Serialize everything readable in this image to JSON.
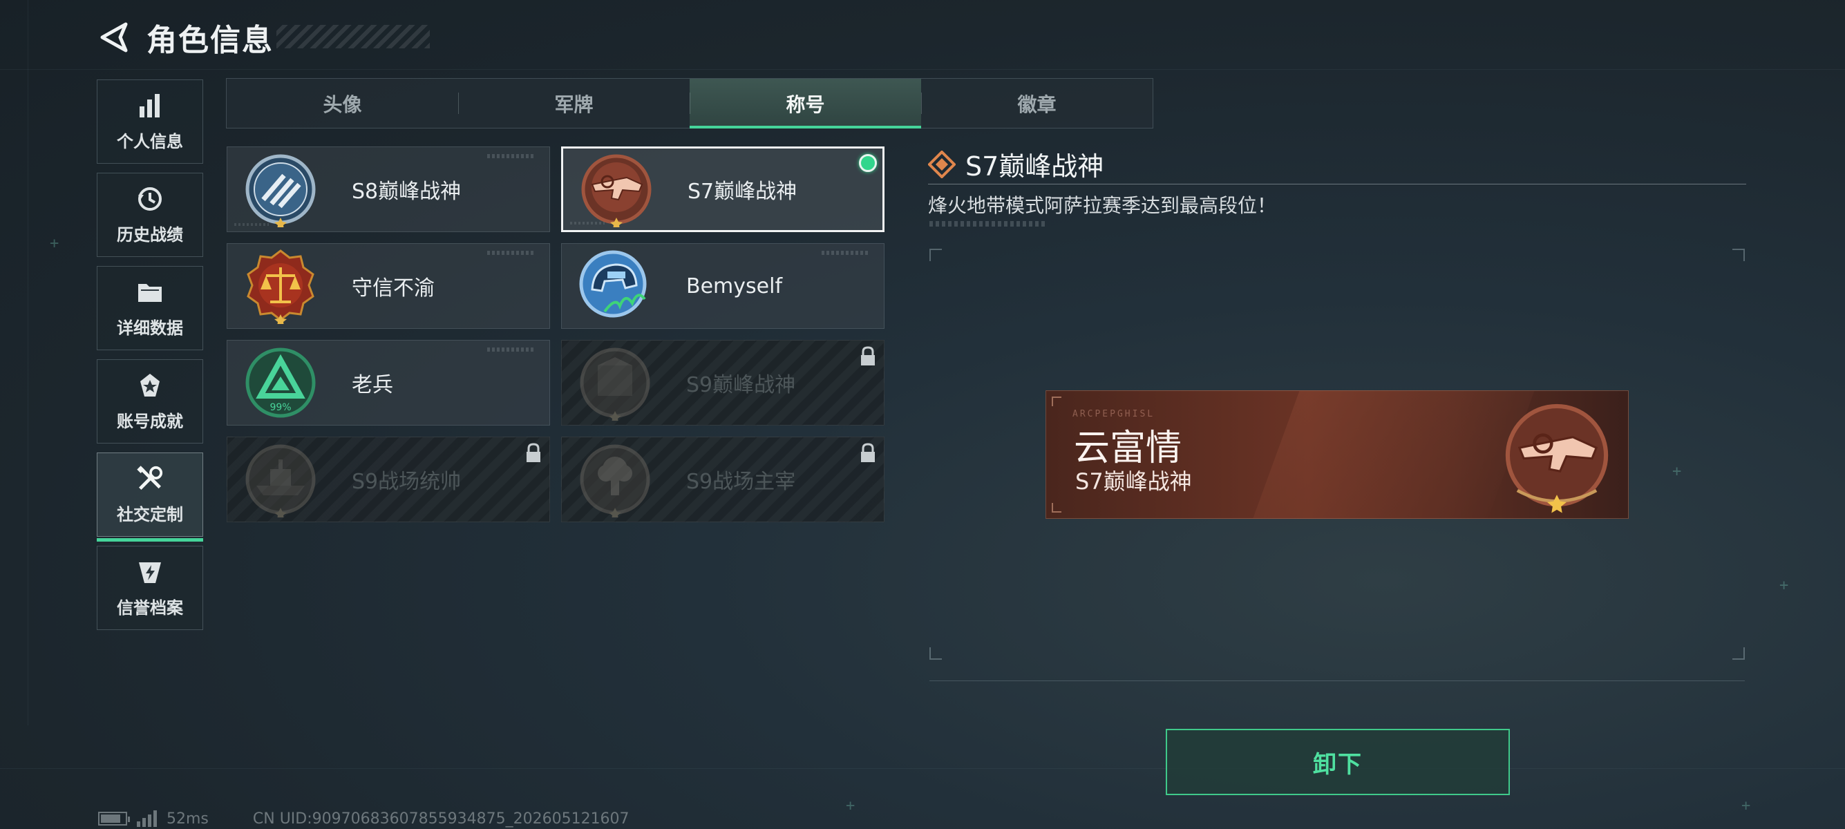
{
  "header": {
    "title": "角色信息"
  },
  "left_nav": {
    "items": [
      {
        "label": "个人信息",
        "icon": "bar-chart-icon"
      },
      {
        "label": "历史战绩",
        "icon": "history-icon"
      },
      {
        "label": "详细数据",
        "icon": "folder-icon"
      },
      {
        "label": "账号成就",
        "icon": "achievement-icon"
      },
      {
        "label": "社交定制",
        "icon": "wrench-icon",
        "active": true
      },
      {
        "label": "信誉档案",
        "icon": "credit-shield-icon"
      }
    ]
  },
  "tabs": [
    {
      "label": "头像"
    },
    {
      "label": "军牌"
    },
    {
      "label": "称号",
      "active": true
    },
    {
      "label": "徽章"
    }
  ],
  "titles": [
    {
      "name": "S8巅峰战神",
      "state": "normal"
    },
    {
      "name": "S7巅峰战神",
      "state": "selected",
      "equipped": true
    },
    {
      "name": "守信不渝",
      "state": "normal"
    },
    {
      "name": "Bemyself",
      "state": "normal"
    },
    {
      "name": "老兵",
      "state": "normal",
      "badge_text": "99%"
    },
    {
      "name": "S9巅峰战神",
      "state": "locked"
    },
    {
      "name": "S9战场统帅",
      "state": "locked"
    },
    {
      "name": "S9战场主宰",
      "state": "locked"
    }
  ],
  "detail": {
    "title": "S7巅峰战神",
    "description": "烽火地带模式阿萨拉赛季达到最高段位！"
  },
  "nameplate": {
    "code_text": "ARCPEPGHISL",
    "player_name": "云富情",
    "title": "S7巅峰战神"
  },
  "actions": {
    "unequip_label": "卸下"
  },
  "status_bar": {
    "ping": "52ms",
    "uid": "CN UID:909706836078559348​75_202605121607"
  },
  "colors": {
    "accent_green": "#45d49a",
    "equipped_dot": "#32d68c",
    "nameplate_bg": "#6a3325",
    "background": "#1c262d"
  }
}
